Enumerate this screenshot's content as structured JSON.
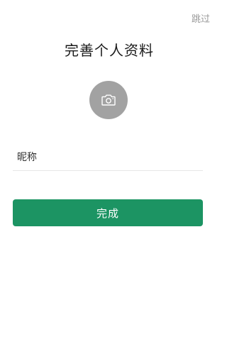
{
  "header": {
    "skip_label": "跳过",
    "title": "完善个人资料"
  },
  "avatar": {
    "icon": "camera-icon"
  },
  "form": {
    "nickname_label": "昵称",
    "nickname_value": "",
    "nickname_placeholder": ""
  },
  "actions": {
    "done_label": "完成"
  },
  "colors": {
    "accent": "#1c9463",
    "avatar_bg": "#a2a2a2",
    "skip_text": "#9a9a9a",
    "divider": "#e6e6e6"
  }
}
